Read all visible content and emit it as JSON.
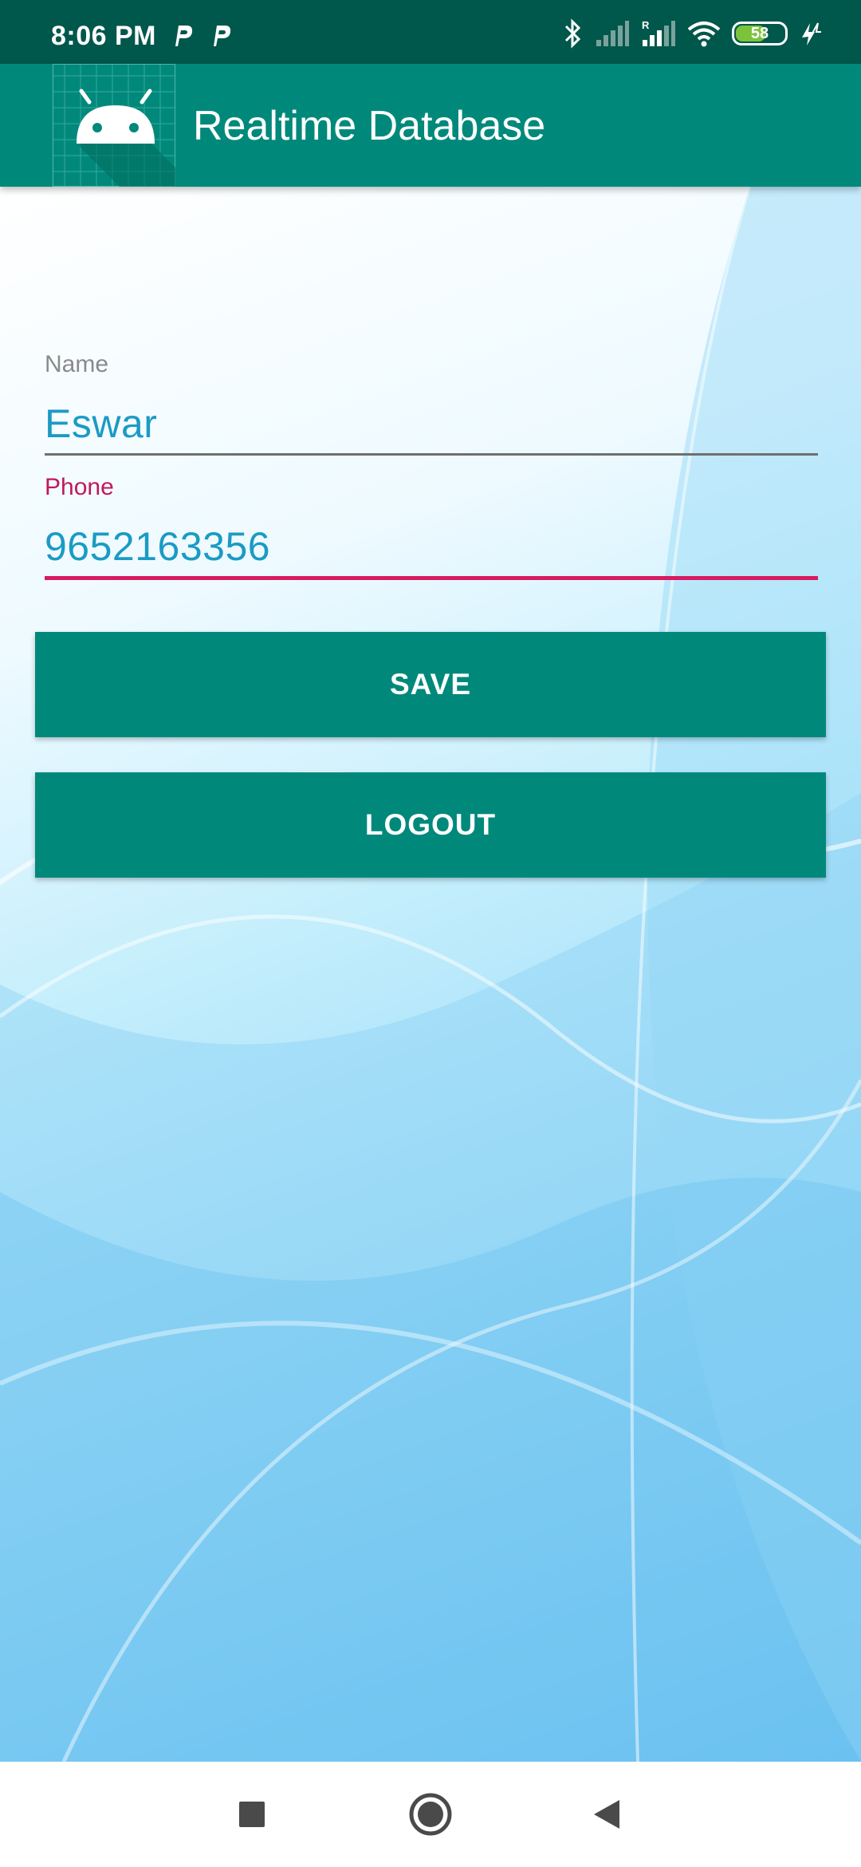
{
  "status_bar": {
    "time": "8:06 PM",
    "notification_icons": [
      "p-app-icon",
      "p-app-icon"
    ],
    "battery_level": "58",
    "icons": [
      "bluetooth-icon",
      "signal-icon",
      "signal-roaming-icon",
      "wifi-icon",
      "battery-icon",
      "charging-icon"
    ]
  },
  "app_bar": {
    "title": "Realtime Database",
    "logo_icon": "android-icon",
    "color": "#00897b"
  },
  "form": {
    "name_label": "Name",
    "name_value": "Eswar",
    "phone_label": "Phone",
    "phone_value": "9652163356"
  },
  "buttons": {
    "save_label": "SAVE",
    "logout_label": "LOGOUT"
  },
  "nav_bar": {
    "icons": [
      "recents-square-icon",
      "home-circle-icon",
      "back-triangle-icon"
    ]
  },
  "colors": {
    "primary": "#00897b",
    "primary_dark": "#00574b",
    "accent": "#d81b60",
    "text_value": "#1a9bc4"
  }
}
